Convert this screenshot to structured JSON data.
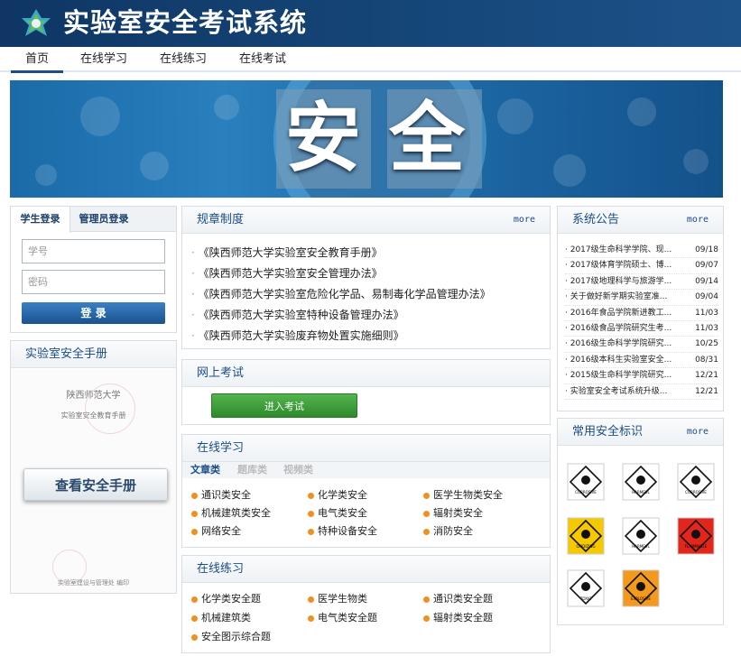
{
  "header": {
    "title": "实验室安全考试系统"
  },
  "nav": {
    "items": [
      "首页",
      "在线学习",
      "在线练习",
      "在线考试"
    ]
  },
  "banner": {
    "chars": [
      "安",
      "全"
    ]
  },
  "login": {
    "tabs": [
      "学生登录",
      "管理员登录"
    ],
    "username_placeholder": "学号",
    "password_placeholder": "密码",
    "submit": "登 录"
  },
  "handbook": {
    "title": "实验室安全手册",
    "cover_school": "陕西师范大学",
    "cover_title": "实验室安全教育手册",
    "cover_footer": "实验室建设与管理处 编印",
    "button": "查看安全手册"
  },
  "rules": {
    "title": "规章制度",
    "more": "more",
    "items": [
      "《陕西师范大学实验室安全教育手册》",
      "《陕西师范大学实验室安全管理办法》",
      "《陕西师范大学实验室危险化学品、易制毒化学品管理办法》",
      "《陕西师范大学实验室特种设备管理办法》",
      "《陕西师范大学实验废弃物处置实施细则》"
    ]
  },
  "exam": {
    "title": "网上考试",
    "button": "进入考试"
  },
  "learning": {
    "title": "在线学习",
    "tabs": [
      "文章类",
      "题库类",
      "视频类"
    ],
    "categories": [
      [
        "通识类安全",
        "化学类安全",
        "医学生物类安全"
      ],
      [
        "机械建筑类安全",
        "电气类安全",
        "辐射类安全"
      ],
      [
        "网络安全",
        "特种设备安全",
        "消防安全"
      ]
    ]
  },
  "practice": {
    "title": "在线练习",
    "categories": [
      [
        "化学类安全题",
        "医学生物类",
        "通识类安全题"
      ],
      [
        "机械建筑类",
        "电气类安全题",
        "辐射类安全题"
      ],
      [
        "安全图示综合题"
      ]
    ]
  },
  "notices": {
    "title": "系统公告",
    "more": "more",
    "items": [
      {
        "text": "2017级生命科学学院、现...",
        "date": "09/18"
      },
      {
        "text": "2017级体育学院硕士、博...",
        "date": "09/07"
      },
      {
        "text": "2017级地理科学与旅游学...",
        "date": "09/14"
      },
      {
        "text": "关于做好新学期实验室准...",
        "date": "09/04"
      },
      {
        "text": "2016年食品学院新进教工...",
        "date": "11/03"
      },
      {
        "text": "2016级食品学院研究生考...",
        "date": "11/03"
      },
      {
        "text": "2016级生命科学学院研究...",
        "date": "10/25"
      },
      {
        "text": "2016级本科生实验室安全...",
        "date": "08/31"
      },
      {
        "text": "2015级生命科学学院研究...",
        "date": "12/21"
      },
      {
        "text": "实验室安全考试系统升级...",
        "date": "12/21"
      }
    ]
  },
  "signs": {
    "title": "常用安全标识",
    "more": "more",
    "items": [
      {
        "label": "CORROSIVE",
        "bg": "#ffffff",
        "icon": "corrosive-sign-icon"
      },
      {
        "label": "HARMFUL",
        "bg": "#ffffff",
        "icon": "harmful-sign-icon"
      },
      {
        "label": "CORROSIVE",
        "bg": "#ffffff",
        "icon": "corrosive-sign-icon"
      },
      {
        "label": "OXIDIZING",
        "bg": "#f5c800",
        "icon": "oxidizing-sign-icon"
      },
      {
        "label": "HARMFUL",
        "bg": "#ffffff",
        "icon": "irritant-sign-icon"
      },
      {
        "label": "FLAMMABLE",
        "bg": "#e3261b",
        "icon": "flammable-sign-icon"
      },
      {
        "label": "TOXIC",
        "bg": "#ffffff",
        "icon": "toxic-sign-icon"
      },
      {
        "label": "EXPLOSIVE",
        "bg": "#f39a1e",
        "icon": "explosive-sign-icon"
      }
    ]
  }
}
